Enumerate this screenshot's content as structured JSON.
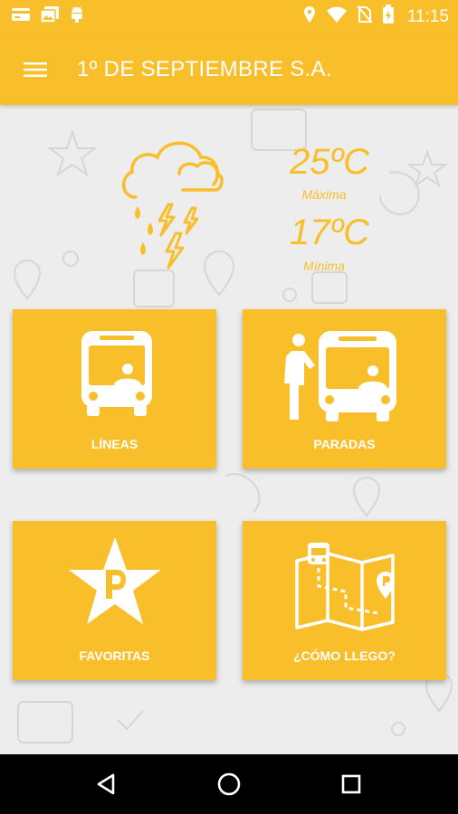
{
  "status_bar": {
    "time": "11:15",
    "icons": [
      "card-icon",
      "images-icon",
      "android-icon",
      "location-icon",
      "wifi-icon",
      "no-sim-icon",
      "battery-charging-icon"
    ]
  },
  "app_bar": {
    "title": "1º DE SEPTIEMBRE S.A.",
    "menu_icon": "hamburger-menu-icon"
  },
  "weather": {
    "icon": "storm-cloud-icon",
    "max_temp": "25ºC",
    "max_label": "Máxima",
    "min_temp": "17ºC",
    "min_label": "Mínima"
  },
  "tiles": [
    {
      "label": "LÍNEAS",
      "icon": "bus-icon"
    },
    {
      "label": "PARADAS",
      "icon": "bus-stop-icon"
    },
    {
      "label": "FAVORITAS",
      "icon": "star-p-icon"
    },
    {
      "label": "¿CÓMO LLEGO?",
      "icon": "map-route-icon"
    }
  ],
  "nav_bar": {
    "icons": [
      "back-icon",
      "home-icon",
      "recents-icon"
    ]
  },
  "colors": {
    "primary": "#f8bf2b",
    "background": "#ededed",
    "nav_bar": "#000000"
  }
}
